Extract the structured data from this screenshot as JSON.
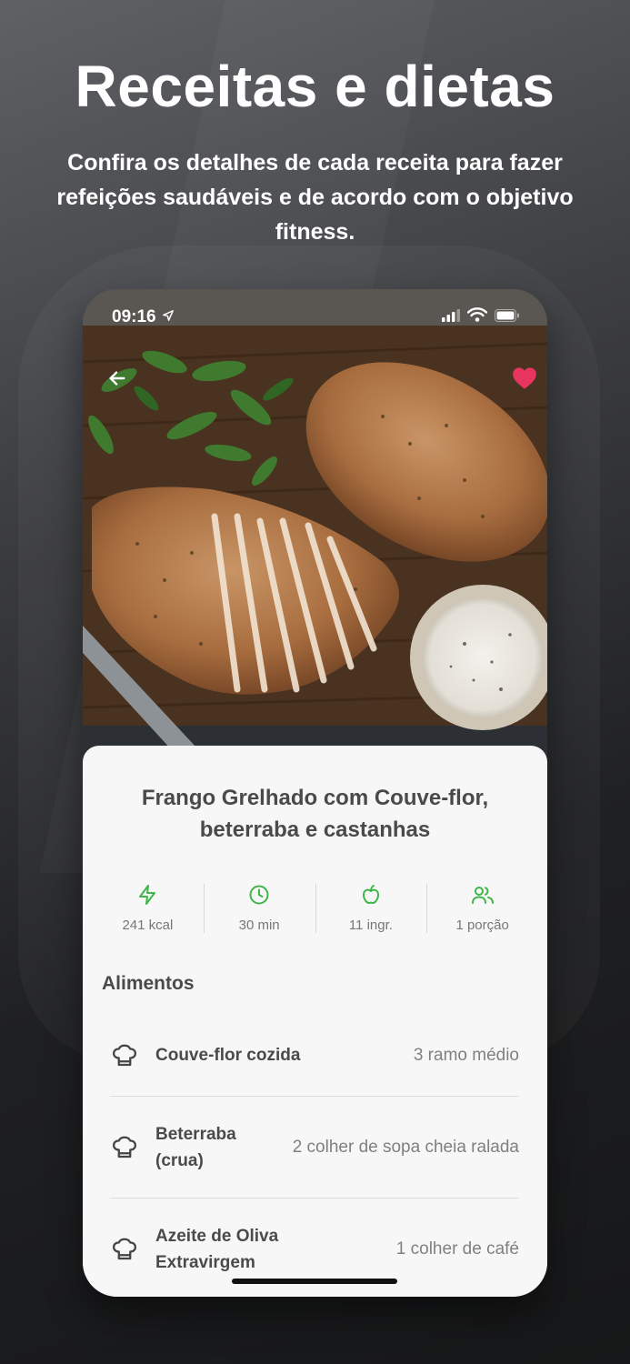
{
  "promo": {
    "headline": "Receitas e dietas",
    "subtitle": "Confira os detalhes de cada receita para fazer refeições saudáveis e de acordo com o objetivo fitness."
  },
  "status_bar": {
    "time": "09:16",
    "icons": [
      "location-arrow-icon",
      "signal-icon",
      "wifi-icon",
      "battery-icon"
    ]
  },
  "header": {
    "back_icon": "arrow-left-icon",
    "favorite_icon": "heart-icon",
    "favorite_color": "#e8355f"
  },
  "recipe": {
    "title": "Frango Grelhado com Couve-flor, beterraba e castanhas",
    "accent_color": "#3fb54a",
    "stats": [
      {
        "icon": "lightning-icon",
        "label": "241 kcal"
      },
      {
        "icon": "clock-icon",
        "label": "30 min"
      },
      {
        "icon": "apple-icon",
        "label": "11 ingr."
      },
      {
        "icon": "users-icon",
        "label": "1 porção"
      }
    ]
  },
  "foods": {
    "section_title": "Alimentos",
    "item_icon": "chef-hat-icon",
    "items": [
      {
        "name": "Couve-flor cozida",
        "quantity": "3 ramo médio"
      },
      {
        "name": "Beterraba (crua)",
        "quantity": "2 colher de sopa cheia ralada"
      },
      {
        "name": "Azeite de Oliva Extravirgem",
        "quantity": "1 colher de café"
      }
    ]
  }
}
